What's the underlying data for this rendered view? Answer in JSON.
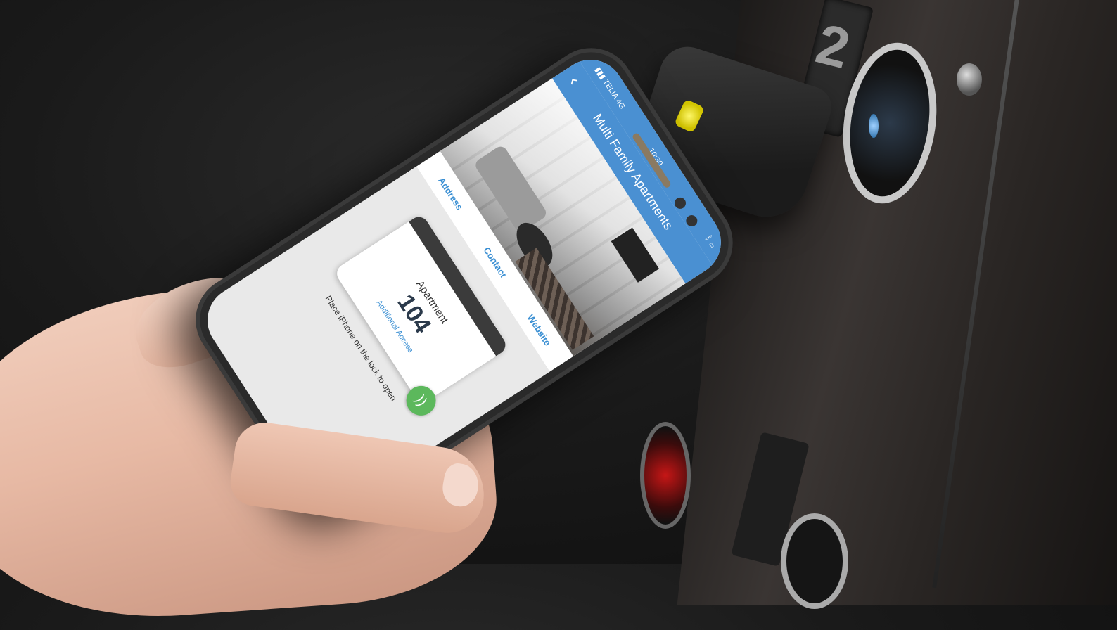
{
  "status_bar": {
    "carrier": "TELIA",
    "network": "4G",
    "time": "10:30"
  },
  "nav": {
    "back_symbol": "‹",
    "title": "Multi Family Apartments"
  },
  "links": {
    "address": "Address",
    "contact": "Contact",
    "website": "Website"
  },
  "access_card": {
    "label": "Apartment",
    "number": "104",
    "sub_label": "Additional Access"
  },
  "nfc_icon": "nfc-wave-icon",
  "hint": "Place iPhone on the lock to open",
  "elevator": {
    "floor_number": "2"
  },
  "colors": {
    "accent": "#4a90d2",
    "link": "#3a8fd3",
    "nfc_green": "#5cb85c"
  }
}
